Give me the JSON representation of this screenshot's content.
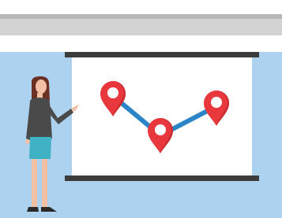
{
  "illustration": {
    "subject": "presenter-pointing-at-map-route-screen",
    "icons": [
      "map-pin-icon",
      "map-pin-icon",
      "map-pin-icon"
    ],
    "colors": {
      "background_panel": "#acd2ef",
      "gray_bar": "#d3d3d3",
      "gray_bar_edge": "#b7b7b7",
      "screen": "#ffffff",
      "screen_rail": "#3c3c3c",
      "route_line": "#2b84c7",
      "pin": "#e8373d",
      "shirt": "#4a4a4a",
      "skirt": "#3fb3c4",
      "hair": "#6b2f24",
      "skin": "#f2c0a4"
    }
  }
}
